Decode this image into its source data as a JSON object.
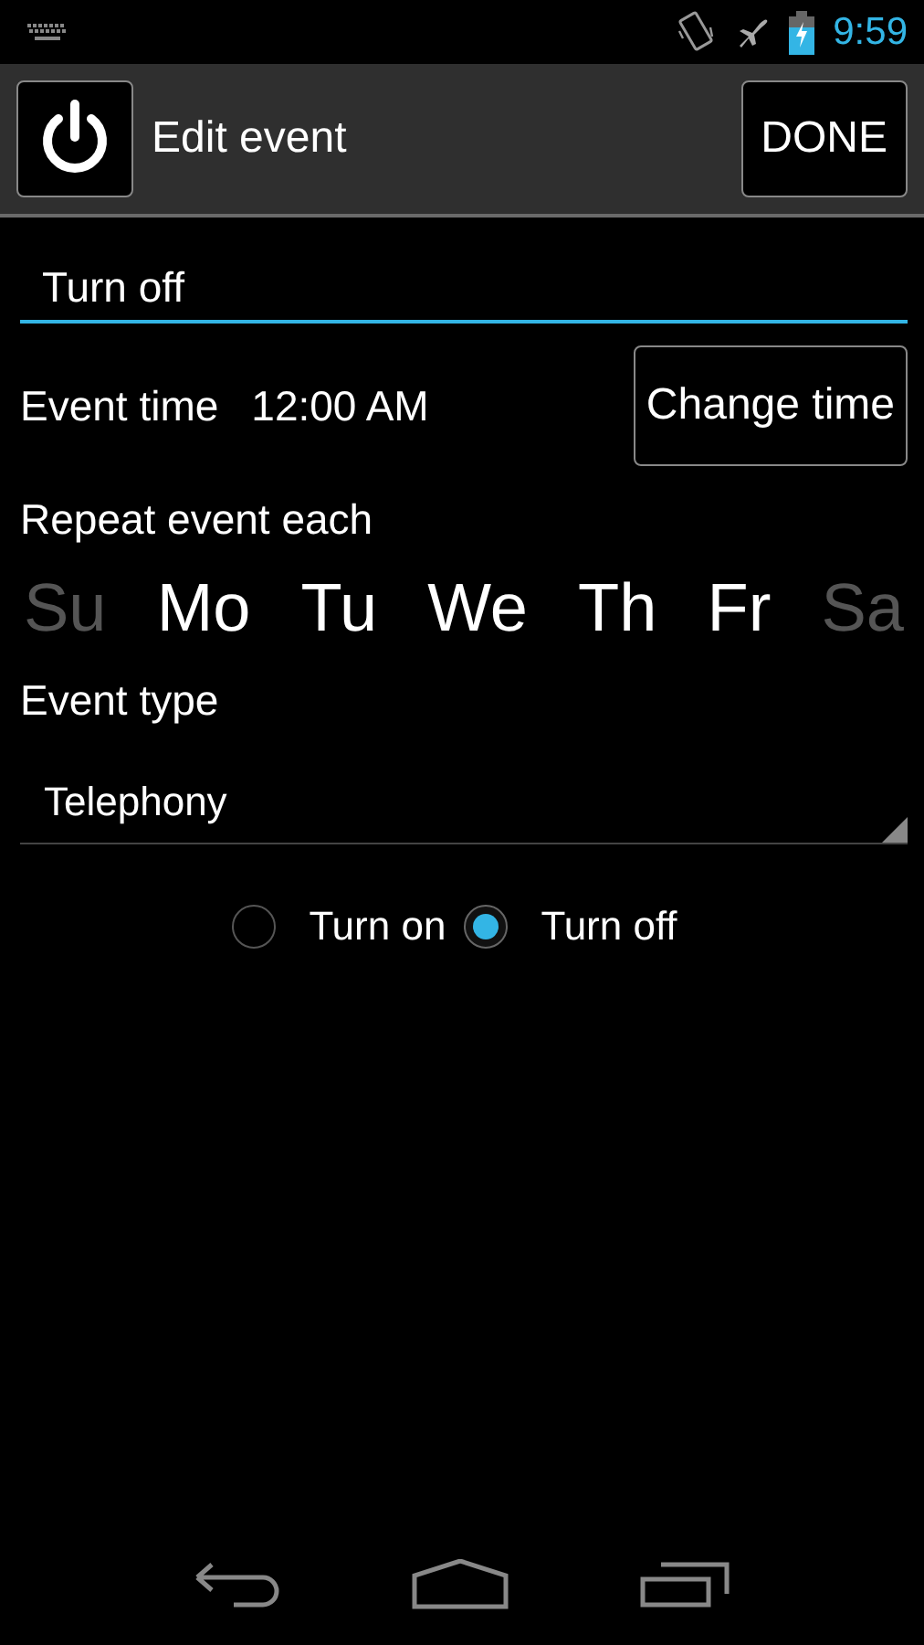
{
  "status_bar": {
    "time": "9:59"
  },
  "action_bar": {
    "title": "Edit event",
    "done_button": "DONE"
  },
  "name_field": {
    "value": "Turn off"
  },
  "event_time": {
    "label": "Event time",
    "value": "12:00 AM",
    "button": "Change time"
  },
  "repeat": {
    "label": "Repeat event each",
    "days": [
      {
        "label": "Su",
        "selected": false
      },
      {
        "label": "Mo",
        "selected": true
      },
      {
        "label": "Tu",
        "selected": true
      },
      {
        "label": "We",
        "selected": true
      },
      {
        "label": "Th",
        "selected": true
      },
      {
        "label": "Fr",
        "selected": true
      },
      {
        "label": "Sa",
        "selected": false
      }
    ]
  },
  "event_type": {
    "label": "Event type",
    "value": "Telephony"
  },
  "action": {
    "options": [
      {
        "label": "Turn on",
        "selected": false
      },
      {
        "label": "Turn off",
        "selected": true
      }
    ]
  }
}
